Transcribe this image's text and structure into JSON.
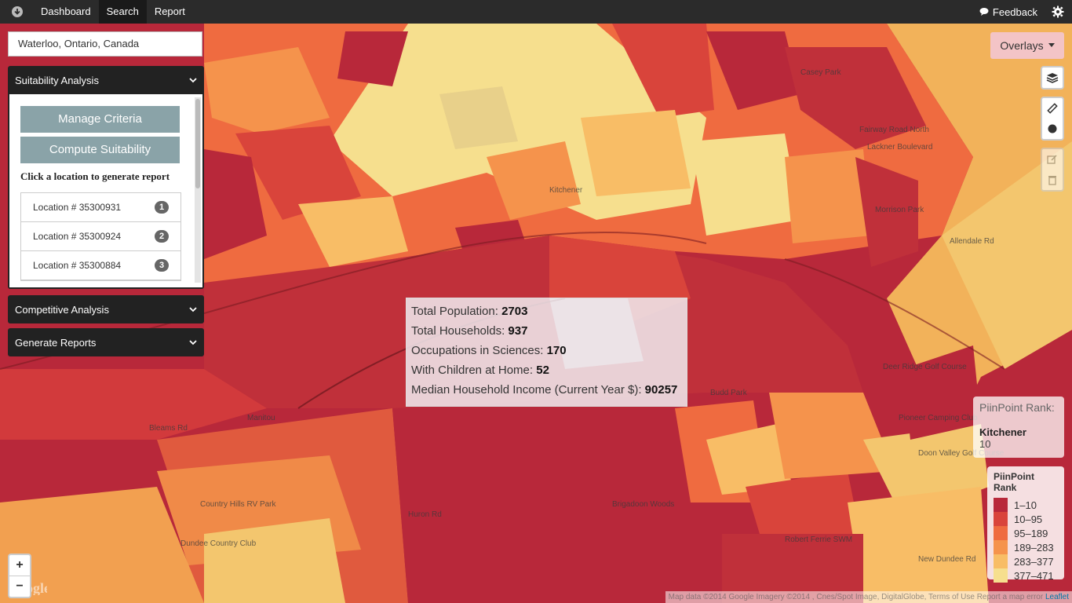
{
  "nav": {
    "logo_icon": "download-circle-icon",
    "items": [
      {
        "label": "Dashboard",
        "active": false
      },
      {
        "label": "Search",
        "active": true
      },
      {
        "label": "Report",
        "active": false
      }
    ],
    "feedback_label": "Feedback",
    "settings_icon": "gear-icon"
  },
  "search": {
    "value": "Waterloo, Ontario, Canada"
  },
  "panels": {
    "suitability": {
      "title": "Suitability Analysis",
      "manage_label": "Manage Criteria",
      "compute_label": "Compute Suitability",
      "hint": "Click a location to generate report",
      "locations": [
        {
          "label": "Location # 35300931",
          "badge": "1"
        },
        {
          "label": "Location # 35300924",
          "badge": "2"
        },
        {
          "label": "Location # 35300884",
          "badge": "3"
        }
      ]
    },
    "competitive": {
      "title": "Competitive Analysis"
    },
    "reports": {
      "title": "Generate Reports"
    }
  },
  "overlays": {
    "label": "Overlays"
  },
  "map_controls": {
    "layers_icon": "layers-icon",
    "ruler_icon": "ruler-icon",
    "point_icon": "circle-marker-icon",
    "edit_icon": "edit-icon",
    "delete_icon": "trash-icon",
    "zoom_in": "+",
    "zoom_out": "−"
  },
  "popup": {
    "rows": [
      {
        "label": "Total Population: ",
        "value": "2703"
      },
      {
        "label": "Total Households: ",
        "value": "937"
      },
      {
        "label": "Occupations in Sciences: ",
        "value": "170"
      },
      {
        "label": "With Children at Home: ",
        "value": "52"
      },
      {
        "label": "Median Household Income (Current Year $): ",
        "value": "90257"
      }
    ]
  },
  "rank": {
    "title": "PiinPoint Rank:",
    "name": "Kitchener",
    "value": "10"
  },
  "legend": {
    "title": "PiinPoint Rank",
    "items": [
      {
        "label": "1–10",
        "color": "#b8283a"
      },
      {
        "label": "10–95",
        "color": "#d9443b"
      },
      {
        "label": "95–189",
        "color": "#ef6b40"
      },
      {
        "label": "189–283",
        "color": "#f5934c"
      },
      {
        "label": "283–377",
        "color": "#f8bd66"
      },
      {
        "label": "377–471",
        "color": "#f6df8e"
      }
    ]
  },
  "map_labels": {
    "kitchener": "Kitchener",
    "deer_ridge": "Deer Ridge Golf Course",
    "pioneer": "Pioneer Camping Club",
    "doon_valley": "Doon Valley Golf Course",
    "brigadoon": "Brigadoon Woods",
    "country_hills": "Country Hills RV Park",
    "dundee": "Dundee Country Club",
    "bleams": "Bleams Rd",
    "huron": "Huron Rd",
    "manitou": "Manitou",
    "fairway": "Fairway Road North",
    "allendale": "Allendale Rd",
    "budd_park": "Budd Park",
    "new_dundee": "New Dundee Rd",
    "robert_ferrie": "Robert Ferrie SWM",
    "lackner": "Lackner Boulevard",
    "morrison": "Morrison Park",
    "casey_park": "Casey Park"
  },
  "attribution": {
    "text": "Map data ©2014 Google Imagery ©2014 , Cnes/Spot Image, DigitalGlobe, Terms of Use Report a map error",
    "leaflet": "Leaflet"
  },
  "google_logo": "Google"
}
